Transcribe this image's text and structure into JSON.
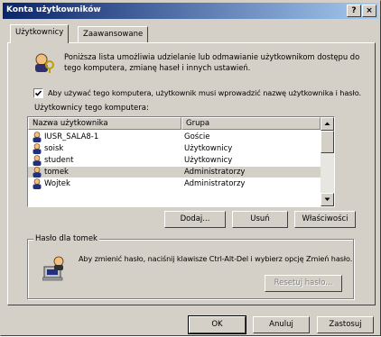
{
  "window": {
    "title": "Konta użytkowników",
    "help_button": "?",
    "close_button": "×"
  },
  "tabs": [
    {
      "label": "Użytkownicy",
      "active": true
    },
    {
      "label": "Zaawansowane",
      "active": false
    }
  ],
  "intro": {
    "line1": "Poniższa lista umożliwia udzielanie lub odmawianie użytkownikom dostępu do",
    "line2": "tego komputera, zmianę haseł i innych ustawień."
  },
  "require_login_checkbox": {
    "checked": true,
    "label": "Aby używać tego komputera, użytkownik musi wprowadzić nazwę użytkownika i hasło."
  },
  "users_label": "Użytkownicy tego komputera:",
  "user_list": {
    "columns": [
      "Nazwa użytkownika",
      "Grupa"
    ],
    "rows": [
      {
        "name": "IUSR_SALA8-1",
        "group": "Goście"
      },
      {
        "name": "soisk",
        "group": "Użytkownicy"
      },
      {
        "name": "student",
        "group": "Użytkownicy"
      },
      {
        "name": "tomek",
        "group": "Administratorzy",
        "selected": true
      },
      {
        "name": "Wojtek",
        "group": "Administratorzy"
      }
    ]
  },
  "list_buttons": {
    "add": "Dodaj...",
    "remove": "Usuń",
    "properties": "Właściwości"
  },
  "password_group": {
    "title": "Hasło dla tomek",
    "text": "Aby zmienić hasło, naciśnij klawisze Ctrl-Alt-Del i wybierz opcję Zmień hasło.",
    "reset_button": "Resetuj hasło..."
  },
  "dialog_buttons": {
    "ok": "OK",
    "cancel": "Anuluj",
    "apply": "Zastosuj"
  },
  "colors": {
    "face": "#d4d0c8",
    "title_start": "#0a246a",
    "title_end": "#a6caf0"
  }
}
